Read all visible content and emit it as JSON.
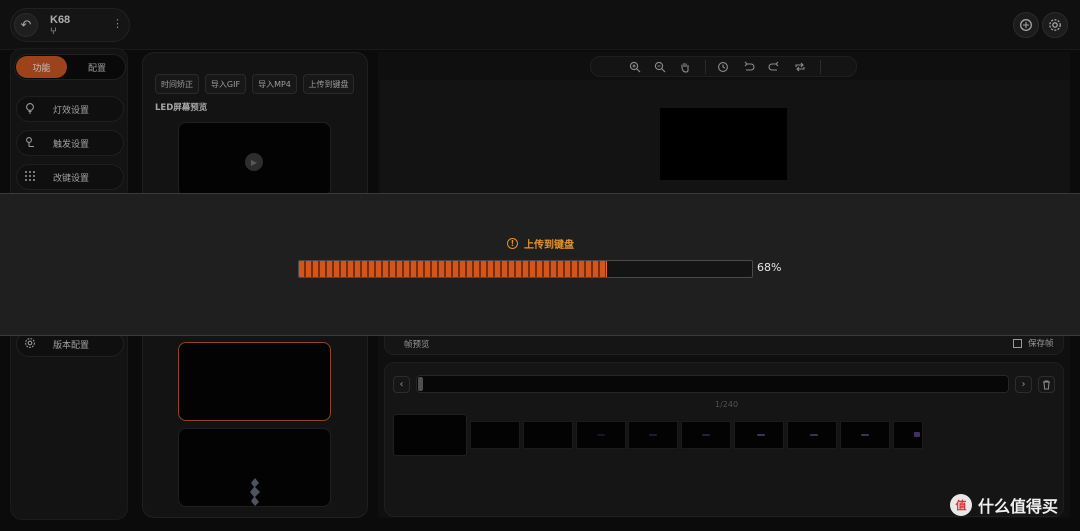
{
  "device": {
    "name": "K68",
    "subtitle": "ⵖ"
  },
  "top_icons": [
    "keyboard-switch-icon",
    "gear-icon"
  ],
  "sidebar": {
    "tabs": [
      {
        "label": "功能",
        "active": true
      },
      {
        "label": "配置",
        "active": false
      }
    ],
    "items": [
      {
        "label": "灯效设置",
        "icon": "bulb-icon"
      },
      {
        "label": "触发设置",
        "icon": "trigger-icon"
      },
      {
        "label": "改键设置",
        "icon": "keypad-icon"
      },
      {
        "label": "版本配置",
        "icon": "gear-icon"
      }
    ]
  },
  "media_panel": {
    "buttons": [
      "时间矫正",
      "导入GIF",
      "导入MP4",
      "上传到键盘"
    ],
    "preview_title": "LED屏幕预览"
  },
  "editor": {
    "tools": [
      "zoom-in-icon",
      "zoom-out-icon",
      "hand-icon",
      "history-icon",
      "undo-icon",
      "redo-icon",
      "loop-icon"
    ],
    "frame_preview_label": "帧预览",
    "save_frame_label": "保存帧",
    "frame_counter": "1/240"
  },
  "upload_modal": {
    "title": "上传到键盘",
    "progress": 0.68,
    "progress_label": "68%",
    "accent_color": "#d0561e",
    "title_color": "#e3932b"
  },
  "watermark": {
    "badge": "值",
    "text": "什么值得买"
  }
}
